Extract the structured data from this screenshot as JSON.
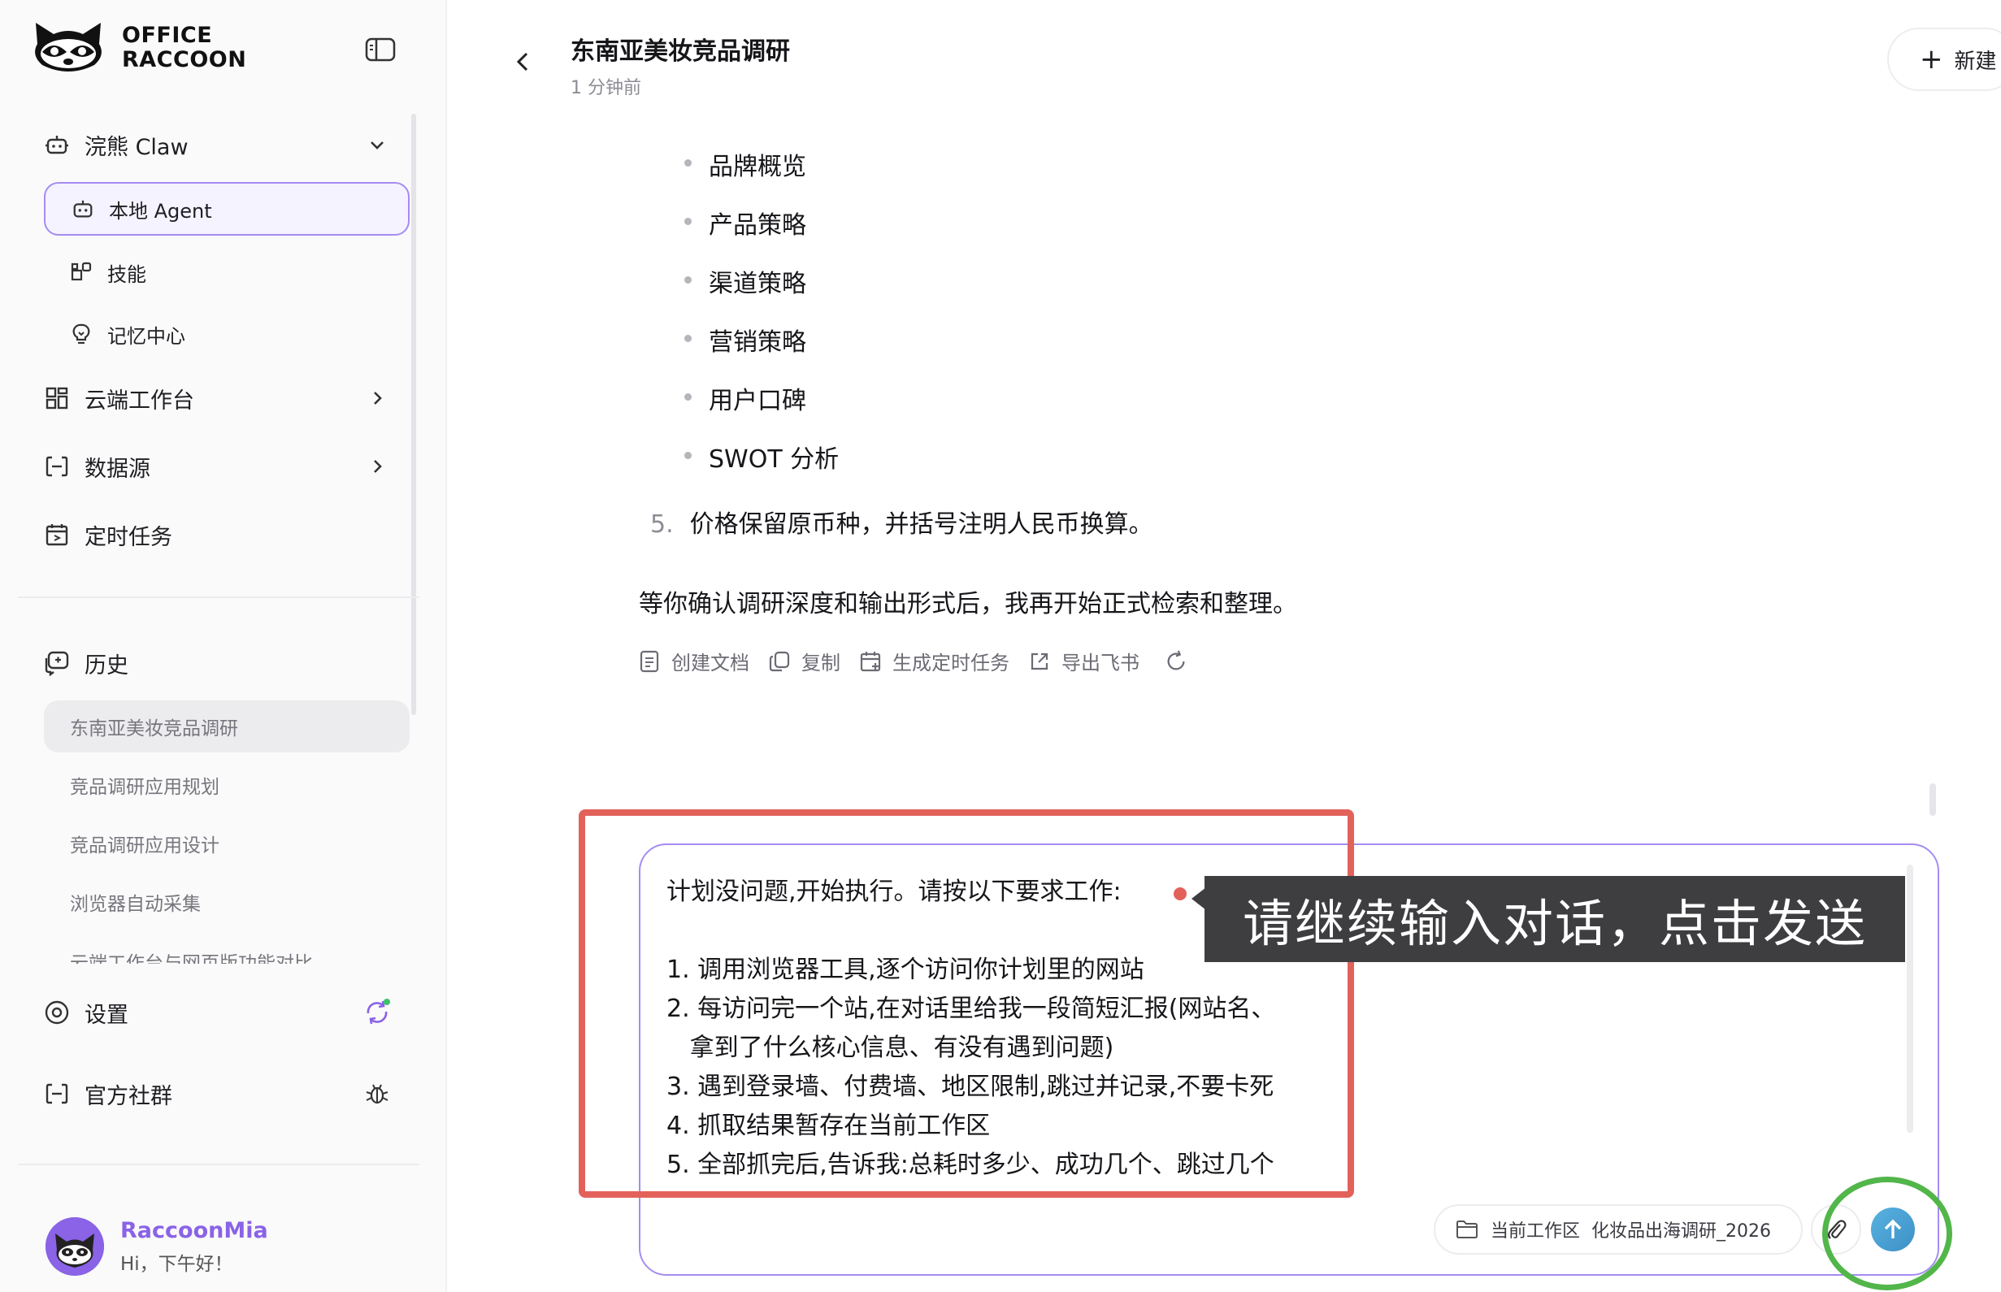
{
  "sidebar": {
    "logo_line1": "OFFICE",
    "logo_line2": "RACCOON",
    "claw": {
      "label": "浣熊 Claw",
      "sub_items": [
        {
          "label": "本地 Agent",
          "icon": "robot-icon"
        },
        {
          "label": "技能",
          "icon": "skills-icon"
        },
        {
          "label": "记忆中心",
          "icon": "bulb-icon"
        }
      ]
    },
    "nav": [
      {
        "label": "云端工作台",
        "icon": "grid-icon"
      },
      {
        "label": "数据源",
        "icon": "datasource-icon"
      },
      {
        "label": "定时任务",
        "icon": "calendar-icon"
      }
    ],
    "history": {
      "label": "历史",
      "items": [
        "东南亚美妆竞品调研",
        "竞品调研应用规划",
        "竞品调研应用设计",
        "浏览器自动采集",
        "云端工作台与网页版功能对比"
      ]
    },
    "settings_label": "设置",
    "community_label": "官方社群",
    "user": {
      "name": "RaccoonMia",
      "greeting": "Hi，下午好！"
    }
  },
  "header": {
    "title": "东南亚美妆竞品调研",
    "time": "1 分钟前",
    "new_label": "新建"
  },
  "message": {
    "bullets": [
      "品牌概览",
      "产品策略",
      "渠道策略",
      "营销策略",
      "用户口碑",
      "SWOT 分析"
    ],
    "numbered_item": {
      "number": "5.",
      "text": "价格保留原币种，并括号注明人民币换算。"
    },
    "closing": "等你确认调研深度和输出形式后，我再开始正式检索和整理。",
    "actions": [
      "创建文档",
      "复制",
      "生成定时任务",
      "导出飞书"
    ]
  },
  "composer": {
    "lines": [
      "计划没问题,开始执行。请按以下要求工作:",
      "",
      "1. 调用浏览器工具,逐个访问你计划里的网站",
      "2. 每访问完一个站,在对话里给我一段简短汇报(网站名、",
      "   拿到了什么核心信息、有没有遇到问题)",
      "3. 遇到登录墙、付费墙、地区限制,跳过并记录,不要卡死",
      "4. 抓取结果暂存在当前工作区",
      "5. 全部抓完后,告诉我:总耗时多少、成功几个、跳过几个"
    ],
    "workspace_label": "当前工作区",
    "workspace_name": "化妆品出海调研_2026"
  },
  "annotation": {
    "tip": "请继续输入对话，点击发送",
    "red_color": "#e2625a",
    "green_color": "#52b64a"
  },
  "colors": {
    "accent": "#8a63e6",
    "border_accent": "#a58cf2",
    "send": "#3d8fc6"
  }
}
